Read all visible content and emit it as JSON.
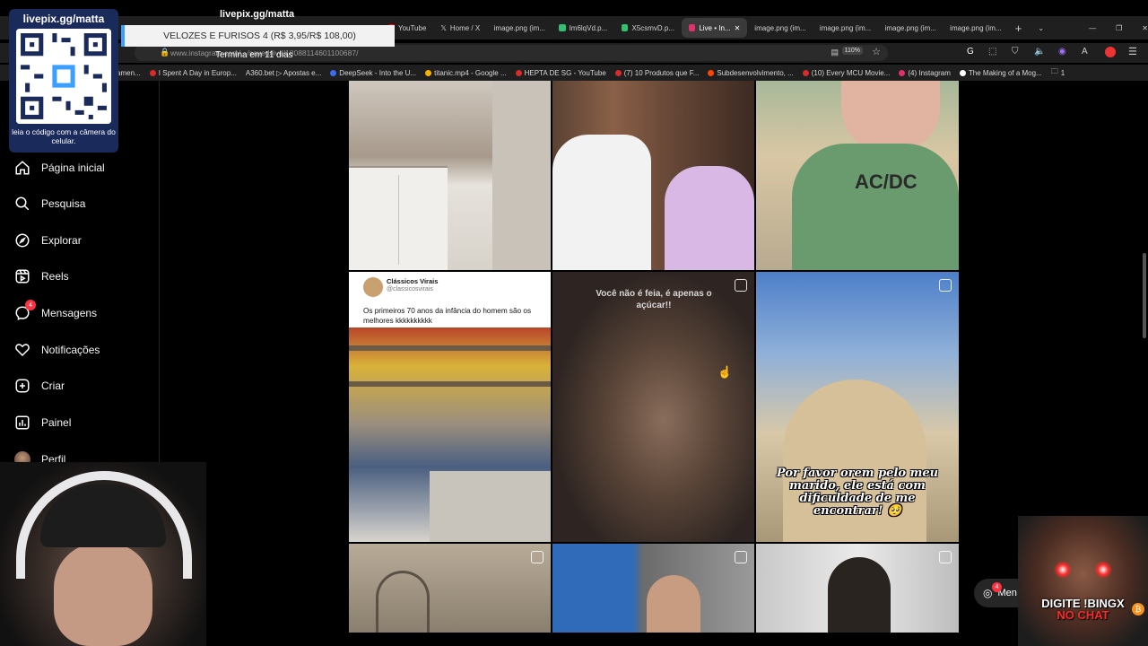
{
  "stream": {
    "livepix_top": "livepix.gg/matta",
    "qr_title": "livepix.gg/matta",
    "qr_caption": "leia o código com a câmera do celular.",
    "donation_text": "VELOZES E FURISOS 4 (R$ 3,95/R$ 108,00)",
    "ends_text": "Termina em 11 dias",
    "bingx_line1": "DIGITE !BINGX",
    "bingx_line2": "NO CHAT"
  },
  "browser": {
    "tabs": [
      {
        "label": "YouTube",
        "color": "#ff0000"
      },
      {
        "label": "Home / X",
        "color": "#ffffff"
      },
      {
        "label": "image.png (im...",
        "color": "#8888ff"
      },
      {
        "label": "Im6lqVd.p...",
        "color": "#30c070"
      },
      {
        "label": "X5csmvD.p...",
        "color": "#30c070"
      },
      {
        "label": "Live • In...",
        "color": "#e1306c",
        "active": true
      },
      {
        "label": "image.png (im...",
        "color": "#8888ff"
      },
      {
        "label": "image.png (im...",
        "color": "#8888ff"
      },
      {
        "label": "image.png (im...",
        "color": "#8888ff"
      },
      {
        "label": "image.png (im...",
        "color": "#8888ff"
      }
    ],
    "url": "www.instagram.com/.../saved/live/18088114601100687/",
    "zoom": "110%",
    "bookmarks": [
      "amen...",
      "I Spent A Day in Europ...",
      "A360.bet ▷ Apostas e...",
      "DeepSeek - Into the U...",
      "titanic.mp4 - Google ...",
      "HEPTA DE SG - YouTube",
      "(7) 10 Produtos que F...",
      "Subdesenvolvimento, ...",
      "(10) Every MCU Movie...",
      "(4) Instagram",
      "The Making of a Mog...",
      "1"
    ]
  },
  "sidebar": {
    "items": [
      {
        "label": "Página inicial",
        "icon": "home-icon"
      },
      {
        "label": "Pesquisa",
        "icon": "search-icon"
      },
      {
        "label": "Explorar",
        "icon": "compass-icon"
      },
      {
        "label": "Reels",
        "icon": "reels-icon"
      },
      {
        "label": "Mensagens",
        "icon": "messenger-icon",
        "badge": "4"
      },
      {
        "label": "Notificações",
        "icon": "heart-icon"
      },
      {
        "label": "Criar",
        "icon": "plus-square-icon"
      },
      {
        "label": "Painel",
        "icon": "dashboard-icon"
      },
      {
        "label": "Perfil",
        "icon": "avatar"
      }
    ]
  },
  "posts": {
    "tweet_name": "Clássicos Virais",
    "tweet_handle": "@classicosvirais",
    "tweet_text": "Os primeiros 70 anos da infância do homem são os melhores kkkkkkkkkk",
    "caption_middle": "Você não é feia, é apenas o açúcar!!",
    "caption_right": "Por favor orem pelo meu marido, ele está com dificuldade de me encontrar! 🥺"
  },
  "messages_pill": {
    "label": "Men",
    "badge": "4"
  }
}
